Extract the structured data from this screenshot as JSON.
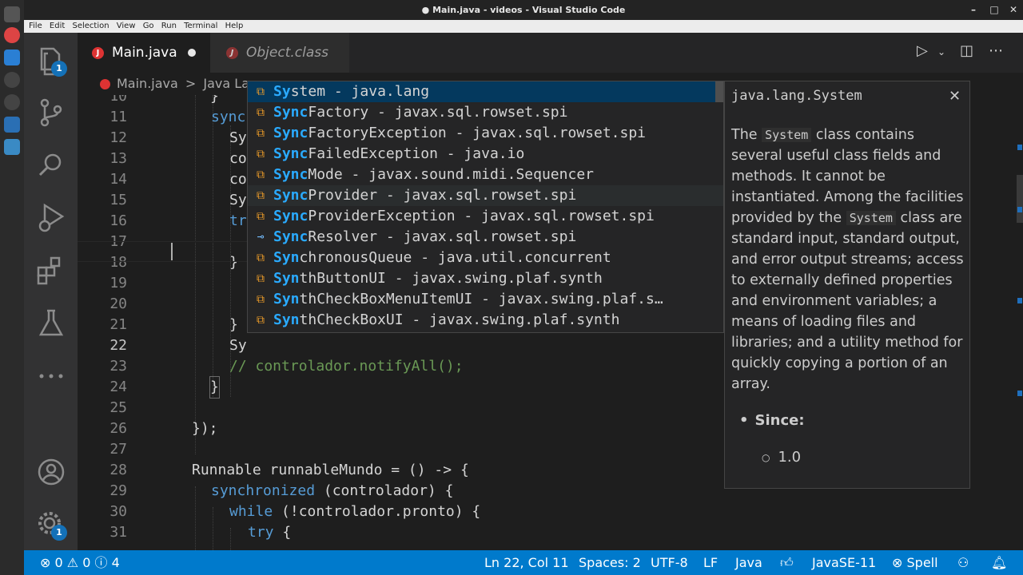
{
  "window": {
    "title": "● Main.java - videos - Visual Studio Code"
  },
  "menubar": {
    "items": [
      "File",
      "Edit",
      "Selection",
      "View",
      "Go",
      "Run",
      "Terminal",
      "Help"
    ]
  },
  "activity": {
    "explorer_badge": "1",
    "settings_badge": "1"
  },
  "tabs": [
    {
      "label": "Main.java",
      "modified": true
    },
    {
      "label": "Object.class",
      "preview": true
    }
  ],
  "breadcrumb": {
    "file": "Main.java",
    "separator": ">",
    "item": "Java La"
  },
  "editor": {
    "lines": [
      {
        "num": "10",
        "text": "}"
      },
      {
        "num": "11",
        "text": "sync"
      },
      {
        "num": "12",
        "text": "Sy"
      },
      {
        "num": "13",
        "text": "co"
      },
      {
        "num": "14",
        "text": "co"
      },
      {
        "num": "15",
        "text": "Sy"
      },
      {
        "num": "16",
        "text": "tr"
      },
      {
        "num": "17",
        "text": ""
      },
      {
        "num": "18",
        "text": "}"
      },
      {
        "num": "19",
        "text": ""
      },
      {
        "num": "20",
        "text": ""
      },
      {
        "num": "21",
        "text": "}"
      },
      {
        "num": "22",
        "text": "Sy"
      },
      {
        "num": "23",
        "text": "// controlador.notifyAll();"
      },
      {
        "num": "24",
        "text": "}"
      },
      {
        "num": "25",
        "text": ""
      },
      {
        "num": "26",
        "text": "});"
      },
      {
        "num": "27",
        "text": ""
      },
      {
        "num": "28",
        "text": "Runnable runnableMundo = () -> {"
      },
      {
        "num": "29a",
        "text": "synchronized"
      },
      {
        "num": "29b",
        "text": " (controlador) {"
      },
      {
        "num": "30a",
        "text": "while"
      },
      {
        "num": "30b",
        "text": " (!controlador.pronto) {"
      },
      {
        "num": "31a",
        "text": "try"
      },
      {
        "num": "31b",
        "text": " {"
      }
    ]
  },
  "suggest": {
    "items": [
      {
        "match": "Sy",
        "rest": "stem",
        "pkg": " - java.lang",
        "icon": "class"
      },
      {
        "match": "Sync",
        "rest": "Factory",
        "pkg": " - javax.sql.rowset.spi",
        "icon": "class"
      },
      {
        "match": "Sync",
        "rest": "FactoryException",
        "pkg": " - javax.sql.rowset.spi",
        "icon": "class"
      },
      {
        "match": "Sync",
        "rest": "FailedException",
        "pkg": " - java.io",
        "icon": "class"
      },
      {
        "match": "Sync",
        "rest": "Mode",
        "pkg": " - javax.sound.midi.Sequencer",
        "icon": "class"
      },
      {
        "match": "Sync",
        "rest": "Provider",
        "pkg": " - javax.sql.rowset.spi",
        "icon": "class"
      },
      {
        "match": "Sync",
        "rest": "ProviderException",
        "pkg": " - javax.sql.rowset.spi",
        "icon": "class"
      },
      {
        "match": "Sync",
        "rest": "Resolver",
        "pkg": " - javax.sql.rowset.spi",
        "icon": "interface"
      },
      {
        "match": "Syn",
        "rest": "chronousQueue",
        "pkg": " - java.util.concurrent",
        "icon": "class"
      },
      {
        "match": "Syn",
        "rest": "thButtonUI",
        "pkg": " - javax.swing.plaf.synth",
        "icon": "class"
      },
      {
        "match": "Syn",
        "rest": "thCheckBoxMenuItemUI",
        "pkg": " - javax.swing.plaf.s…",
        "icon": "class"
      },
      {
        "match": "Syn",
        "rest": "thCheckBoxUI",
        "pkg": " - javax.swing.plaf.synth",
        "icon": "class"
      }
    ]
  },
  "details": {
    "title": "java.lang.System",
    "close": "✕",
    "desc_1": "The ",
    "code_1": "System",
    "desc_2": " class contains several useful class fields and methods. It cannot be instantiated. Among the facilities provided by the ",
    "code_2": "System",
    "desc_3": " class are standard input, standard output, and error output streams; access to externally defined properties and environment variables; a means of loading files and libraries; and a utility method for quickly copying a portion of an array.",
    "since_label": "Since:",
    "since_value": "1.0"
  },
  "statusbar": {
    "errors": "0",
    "warnings": "0",
    "infos": "4",
    "position": "Ln 22, Col 11",
    "spaces": "Spaces: 2",
    "encoding": "UTF-8",
    "eol": "LF",
    "language": "Java",
    "jdk": "JavaSE-11",
    "spell": "Spell"
  },
  "colors": {
    "accent": "#007acc",
    "keyword": "#569cd6",
    "comment": "#6a9955",
    "match": "#2aaaff",
    "class_icon": "#ee9d28"
  }
}
